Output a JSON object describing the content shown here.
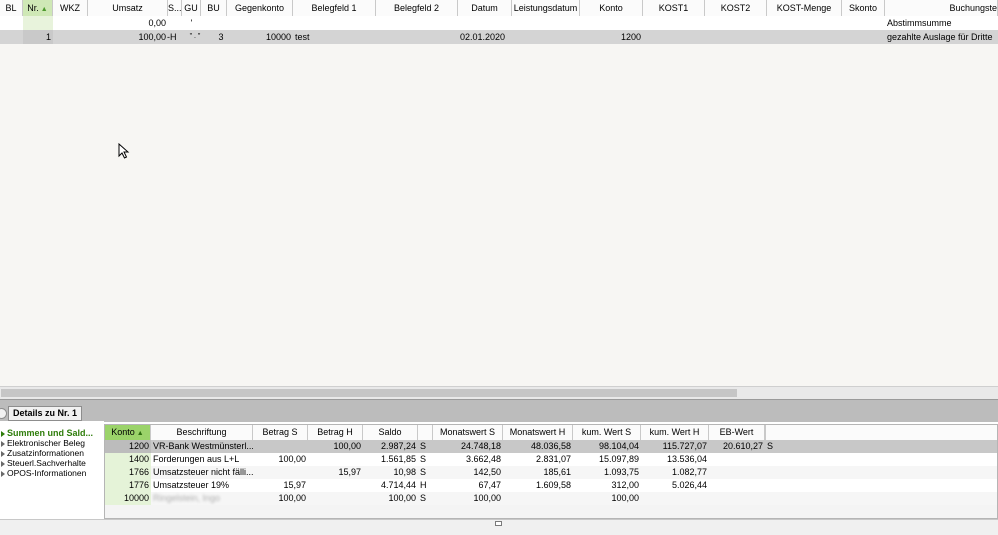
{
  "top_grid": {
    "columns": [
      "BL",
      "Nr.",
      "WKZ",
      "Umsatz",
      "S...",
      "GU",
      "BU",
      "Gegenkonto",
      "Belegfeld 1",
      "Belegfeld 2",
      "Datum",
      "Leistungsdatum",
      "Konto",
      "KOST1",
      "KOST2",
      "KOST-Menge",
      "Skonto",
      "Buchungste"
    ],
    "sum_row": {
      "umsatz": "0,00",
      "s": "'",
      "text": "Abstimmsumme"
    },
    "data_row": {
      "nr": "1",
      "umsatz": "100,00",
      "s": "-H",
      "gu": "\" . \"",
      "bu": "3",
      "gegenkonto": "10000",
      "belegfeld1": "test",
      "datum": "02.01.2020",
      "konto": "1200",
      "text": "gezahlte Auslage für Dritte"
    }
  },
  "details": {
    "tab_label": "Details zu Nr. 1",
    "nav": [
      {
        "label": "Summen und Sald...",
        "active": true
      },
      {
        "label": "Elektronischer Beleg",
        "active": false
      },
      {
        "label": "Zusatzinformationen",
        "active": false
      },
      {
        "label": "Steuerl.Sachverhalte",
        "active": false
      },
      {
        "label": "OPOS-Informationen",
        "active": false
      }
    ],
    "columns": [
      "Konto",
      "Beschriftung",
      "Betrag S",
      "Betrag H",
      "Saldo",
      "",
      "Monatswert S",
      "Monatswert H",
      "kum. Wert S",
      "kum. Wert H",
      "EB-Wert",
      ""
    ],
    "rows": [
      {
        "konto": "1200",
        "beschriftung": "VR-Bank  Westmünsterl...",
        "betrag_s": "",
        "betrag_h": "100,00",
        "saldo": "2.987,24",
        "sh": "S",
        "mon_s": "24.748,18",
        "mon_h": "48.036,58",
        "kum_s": "98.104,04",
        "kum_h": "115.727,07",
        "eb": "20.610,27",
        "eb_sh": "S"
      },
      {
        "konto": "1400",
        "beschriftung": "Forderungen aus L+L",
        "betrag_s": "100,00",
        "betrag_h": "",
        "saldo": "1.561,85",
        "sh": "S",
        "mon_s": "3.662,48",
        "mon_h": "2.831,07",
        "kum_s": "15.097,89",
        "kum_h": "13.536,04",
        "eb": "",
        "eb_sh": ""
      },
      {
        "konto": "1766",
        "beschriftung": "Umsatzsteuer nicht fälli...",
        "betrag_s": "",
        "betrag_h": "15,97",
        "saldo": "10,98",
        "sh": "S",
        "mon_s": "142,50",
        "mon_h": "185,61",
        "kum_s": "1.093,75",
        "kum_h": "1.082,77",
        "eb": "",
        "eb_sh": ""
      },
      {
        "konto": "1776",
        "beschriftung": "Umsatzsteuer 19%",
        "betrag_s": "15,97",
        "betrag_h": "",
        "saldo": "4.714,44",
        "sh": "H",
        "mon_s": "67,47",
        "mon_h": "1.609,58",
        "kum_s": "312,00",
        "kum_h": "5.026,44",
        "eb": "",
        "eb_sh": ""
      },
      {
        "konto": "10000",
        "beschriftung": "Ringelstein, Ingo",
        "betrag_s": "100,00",
        "betrag_h": "",
        "saldo": "100,00",
        "sh": "S",
        "mon_s": "100,00",
        "mon_h": "",
        "kum_s": "100,00",
        "kum_h": "",
        "eb": "",
        "eb_sh": ""
      }
    ]
  },
  "colors": {
    "sorted_header": "#cfe8b6",
    "sorted_header_dark": "#9bd36a",
    "selected_row": "#d4d4d4",
    "panel_bar": "#bcbcbc",
    "nav_active": "#2e7d0a"
  },
  "icons": {
    "sort": "sort-asc-icon",
    "cursor": "mouse-pointer-icon",
    "nav": "triangle-right-icon"
  }
}
